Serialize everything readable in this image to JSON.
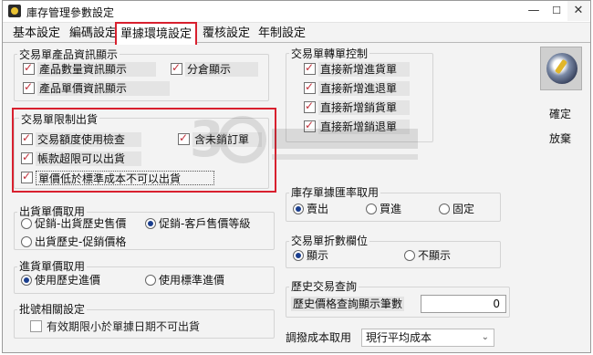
{
  "window": {
    "title": "庫存管理參數設定",
    "min_label": "—",
    "max_label": "☐",
    "close_label": "✕"
  },
  "tabs": [
    {
      "label": "基本設定"
    },
    {
      "label": "編碼設定"
    },
    {
      "label": "單據環境設定",
      "active": true
    },
    {
      "label": "覆核設定"
    },
    {
      "label": "年制設定"
    }
  ],
  "product_info": {
    "title": "交易單產品資訊顯示",
    "items": [
      {
        "label": "產品數量資訊顯示",
        "checked": true
      },
      {
        "label": "分倉顯示",
        "checked": true
      },
      {
        "label": "產品單價資訊顯示",
        "checked": true
      }
    ]
  },
  "restriction": {
    "title": "交易單限制出貨",
    "items": [
      {
        "label": "交易額度使用檢查",
        "checked": true
      },
      {
        "label": "含未銷訂單",
        "checked": true
      },
      {
        "label": "帳款超限可以出貨",
        "checked": true
      },
      {
        "label": "單價低於標準成本不可以出貨",
        "checked": true
      }
    ]
  },
  "transfer": {
    "title": "交易單轉單控制",
    "items": [
      {
        "label": "直接新增進貨單",
        "checked": true
      },
      {
        "label": "直接新增進退單",
        "checked": true
      },
      {
        "label": "直接新增銷貨單",
        "checked": true
      },
      {
        "label": "直接新增銷退單",
        "checked": true
      }
    ]
  },
  "sale_price": {
    "title": "出貨單價取用",
    "options": [
      {
        "label": "促銷-出貨歷史售價",
        "selected": false
      },
      {
        "label": "促銷-客戶售價等級",
        "selected": true
      },
      {
        "label": "出貨歷史-促銷價格",
        "selected": false
      }
    ]
  },
  "purchase_price": {
    "title": "進貨單價取用",
    "options": [
      {
        "label": "使用歷史進價",
        "selected": true
      },
      {
        "label": "使用標準進價",
        "selected": false
      }
    ]
  },
  "batch": {
    "title": "批號相關設定",
    "items": [
      {
        "label": "有效期限小於單據日期不可出貨",
        "checked": false
      }
    ]
  },
  "exchange_rate": {
    "title": "庫存單據匯率取用",
    "options": [
      {
        "label": "賣出",
        "selected": true
      },
      {
        "label": "買進",
        "selected": false
      },
      {
        "label": "固定",
        "selected": false
      }
    ]
  },
  "discount": {
    "title": "交易單折數欄位",
    "options": [
      {
        "label": "顯示",
        "selected": true
      },
      {
        "label": "不顯示",
        "selected": false
      }
    ]
  },
  "history": {
    "title": "歷史交易查詢",
    "field_label": "歷史價格查詢顯示筆數",
    "field_value": "0"
  },
  "cost": {
    "label": "調撥成本取用",
    "value": "現行平均成本"
  },
  "buttons": {
    "confirm": "確定",
    "cancel": "放棄"
  },
  "colors": {
    "highlight": "#d8202e",
    "check": "#c0303a",
    "radio": "#1a3e8e"
  }
}
